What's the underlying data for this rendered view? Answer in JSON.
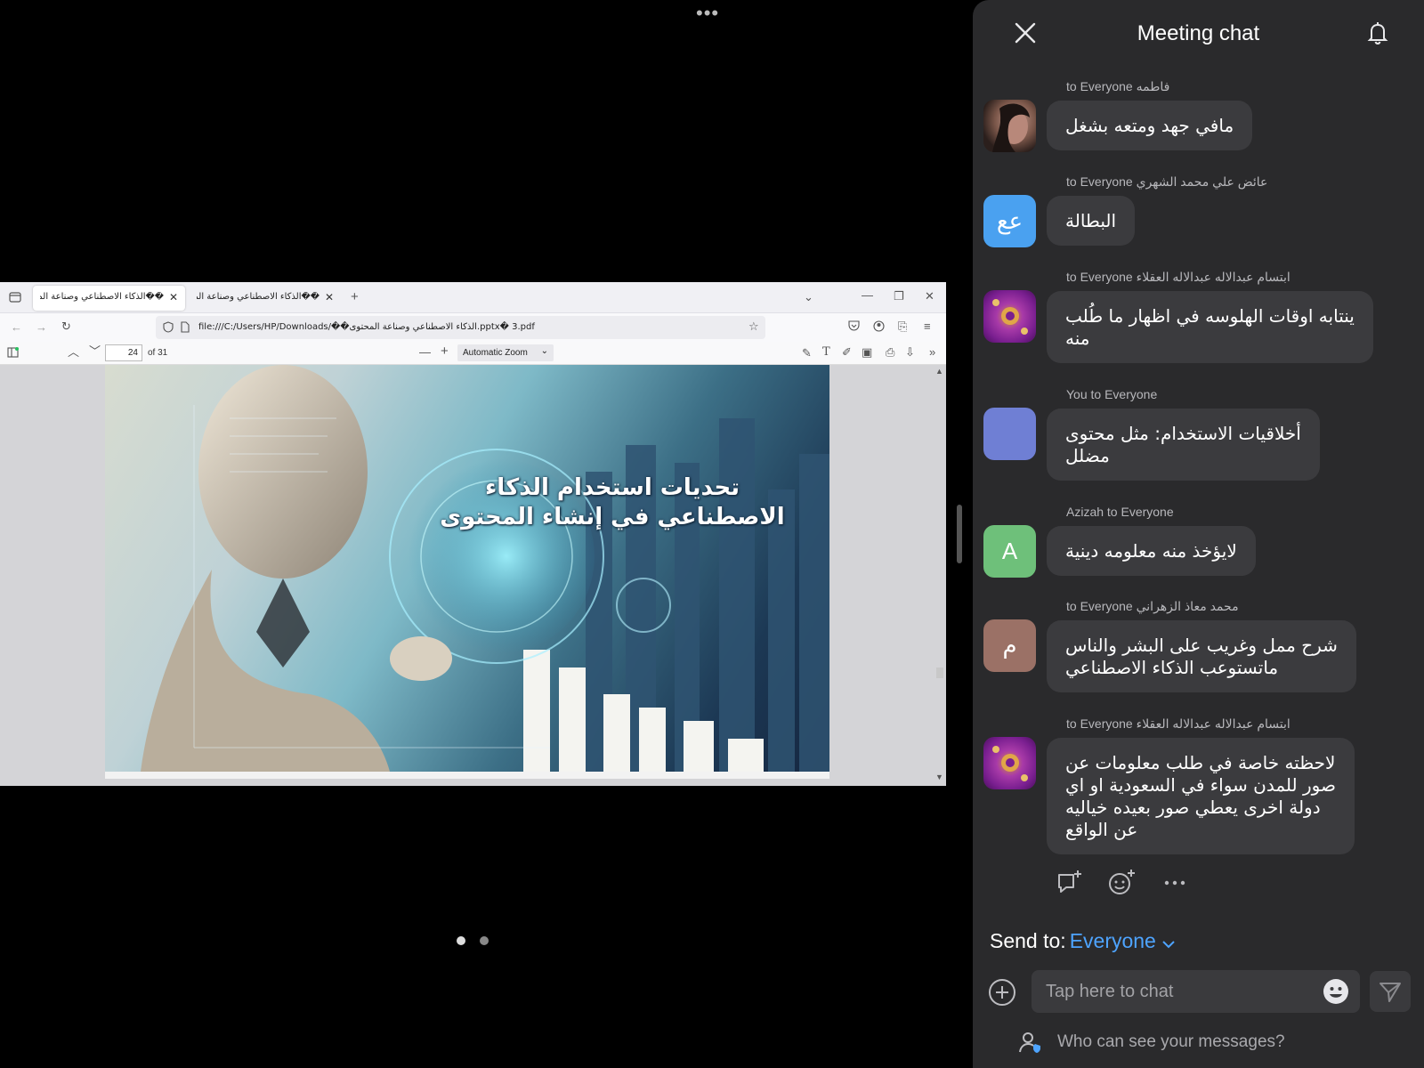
{
  "screen_share": {
    "more_menu": "•••",
    "browser": {
      "tabs": [
        {
          "label": "��الذكاء الاصطناعي وصناعة المحتو",
          "active": true
        },
        {
          "label": "��الذكاء الاصطناعي وصناعة المحتو",
          "active": false
        }
      ],
      "new_tab_glyph": "+",
      "url": "file:///C:/Users/HP/Downloads/��الذكاء الاصطناعي وصناعة المحتوى.pptx� 3.pdf",
      "pdf_toolbar": {
        "page_number": "24",
        "page_count": "of 31",
        "zoom": "Automatic Zoom"
      },
      "slide": {
        "title_line1": "تحديات استخدام الذكاء",
        "title_line2": "الاصطناعي في إنشاء المحتوى"
      }
    },
    "pager_dots": [
      {
        "active": true
      },
      {
        "active": false
      }
    ]
  },
  "chat": {
    "title": "Meeting chat",
    "messages": [
      {
        "sender": "to Everyone فاطمه",
        "avatar": "photo",
        "avatar_text": "",
        "text": [
          "مافي جهد ومتعه بشغل"
        ]
      },
      {
        "sender": "to Everyone عائض علي محمد الشهري",
        "avatar": "blue",
        "avatar_text": "عع",
        "text": [
          "البطالة"
        ]
      },
      {
        "sender": "to Everyone ابتسام عبدالاله عبدالاله العقلاء",
        "avatar": "purple",
        "avatar_text": "",
        "text": [
          "ينتابه اوقات الهلوسه في اظهار ما طُلب",
          "منه"
        ]
      },
      {
        "sender": "You to Everyone",
        "avatar": "periwinkle",
        "avatar_text": "",
        "text": [
          "أخلاقيات الاستخدام: مثل محتوى",
          "مضلل"
        ]
      },
      {
        "sender": "Azizah to Everyone",
        "avatar": "green",
        "avatar_text": "A",
        "text": [
          "لايؤخذ منه معلومه دينية"
        ]
      },
      {
        "sender": "to Everyone محمد معاذ الزهراني",
        "avatar": "brown",
        "avatar_text": "م",
        "text": [
          "شرح ممل وغريب على البشر والناس",
          "ماتستوعب الذكاء الاصطناعي"
        ]
      },
      {
        "sender": "to Everyone ابتسام عبدالاله عبدالاله العقلاء",
        "avatar": "purple",
        "avatar_text": "",
        "text": [
          "لاحظته خاصة في طلب معلومات عن",
          "صور للمدن سواء في السعودية او اي",
          "دولة اخرى يعطي صور بعيده خياليه",
          "عن الواقع"
        ]
      }
    ],
    "send_to_label": "Send to:",
    "send_to_target": "Everyone",
    "input_placeholder": "Tap here to chat",
    "privacy_link": "Who can see your messages?"
  },
  "colors": {
    "panel_bg": "#2a2a2c",
    "bubble_bg": "#3b3b3e",
    "accent": "#4ea4ff"
  }
}
